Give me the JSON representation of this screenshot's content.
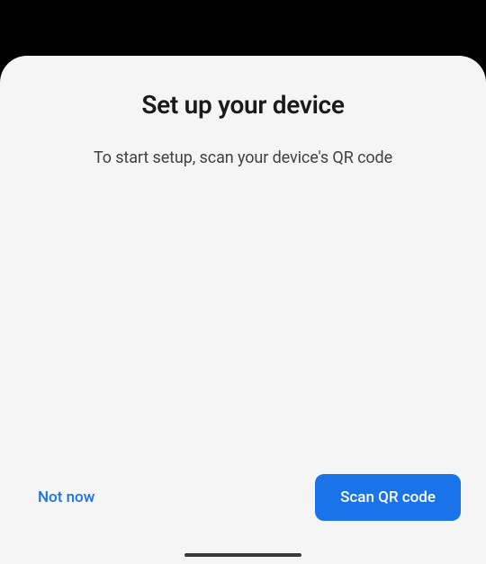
{
  "dialog": {
    "title": "Set up your device",
    "subtitle": "To start setup, scan your device's QR code"
  },
  "actions": {
    "not_now_label": "Not now",
    "scan_label": "Scan QR code"
  }
}
